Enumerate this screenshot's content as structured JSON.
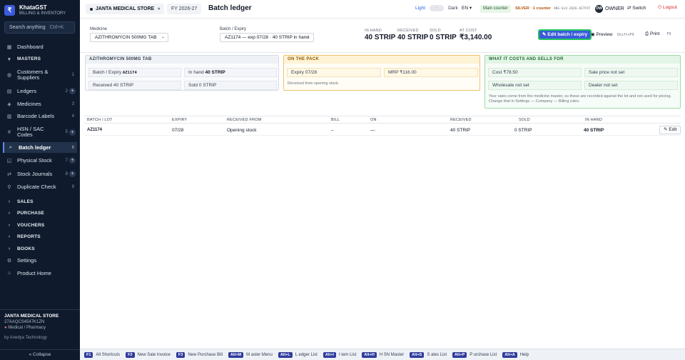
{
  "brand": {
    "logo": "₹",
    "name": "KhataGST",
    "sub": "BILLING & INVENTORY"
  },
  "sidebar": {
    "search_placeholder": "Search anything",
    "search_kbd": "Ctrl+K",
    "items": [
      {
        "label": "Dashboard",
        "icon": "▦"
      },
      {
        "label": "MASTERS",
        "icon": "▾"
      },
      {
        "label": "Customers & Suppliers",
        "icon": "◍",
        "count": "1"
      },
      {
        "label": "Ledgers",
        "icon": "▤",
        "count": "2"
      },
      {
        "label": "Medicines",
        "icon": "◈",
        "count": "3"
      },
      {
        "label": "Barcode Labels",
        "icon": "▥",
        "count": "4"
      },
      {
        "label": "HSN / SAC Codes",
        "icon": "#",
        "count": "5"
      },
      {
        "label": "Batch ledger",
        "icon": "⌕",
        "count": "6"
      },
      {
        "label": "Physical Stock",
        "icon": "◱",
        "count": "7"
      },
      {
        "label": "Stock Journals",
        "icon": "⇄",
        "count": "8"
      },
      {
        "label": "Duplicate Check",
        "icon": "⚲",
        "count": "9"
      },
      {
        "label": "SALES",
        "icon": "›"
      },
      {
        "label": "PURCHASE",
        "icon": "›"
      },
      {
        "label": "VOUCHERS",
        "icon": "›"
      },
      {
        "label": "REPORTS",
        "icon": "›"
      },
      {
        "label": "BOOKS",
        "icon": "›"
      },
      {
        "label": "Settings",
        "icon": "⚙"
      },
      {
        "label": "Product Home",
        "icon": "⌂"
      }
    ],
    "plus": "+",
    "footer": {
      "store": "JANTA MEDICAL STORE",
      "gstin": "27AAQCS4547K1ZN",
      "type": "Medical / Pharmacy",
      "by": "by Anedya Technology"
    },
    "collapse": "« Collapse"
  },
  "topbar": {
    "store": "JANTA MEDICAL STORE",
    "fy": "FY 2026-27",
    "title": "Batch ledger",
    "light": "Light",
    "dark": "Dark",
    "lang": "EN",
    "main_counter": "Main counter",
    "plan": "SILVER · 1 counter",
    "plan_code": "ANS-SLV-2026-4E7F97",
    "avatar": "OW",
    "role": "OWNER",
    "switch": "Switch",
    "logout": "Logout"
  },
  "filters": {
    "medicine_label": "Medicine",
    "medicine_value": "AZITHROMYCIN 500MG TAB",
    "batch_label": "Batch / Expiry",
    "batch_value": "AZ1174 — exp 07/28 · 40 STRIP in hand"
  },
  "stats": [
    {
      "label": "IN HAND",
      "value": "40 STRIP"
    },
    {
      "label": "RECEIVED",
      "value": "40 STRIP"
    },
    {
      "label": "SOLD",
      "value": "0 STRIP"
    },
    {
      "label": "AT COST",
      "value": "₹3,140.00"
    }
  ],
  "actions": {
    "edit": "✎ Edit batch / expiry",
    "preview": "◉ Preview",
    "preview_kbd": "Shift+F9",
    "print": "⎙ Print",
    "print_kbd": "F9"
  },
  "card_batch": {
    "title": "AZITHROMYCIN 500MG TAB",
    "batch_label": "Batch / Expiry",
    "batch_value": "AZ1174",
    "inhand_label": "In hand",
    "inhand_value": "40 STRIP",
    "received_label": "Received",
    "received_value": "40 STRIP",
    "sold_label": "Sold",
    "sold_value": "0 STRIP"
  },
  "card_pack": {
    "title": "ON THE PACK",
    "expiry_label": "Expiry",
    "expiry_value": "07/28",
    "mrp_label": "MRP",
    "mrp_value": "₹116.00",
    "note": "Received from opening stock."
  },
  "card_costs": {
    "title": "WHAT IT COSTS AND SELLS FOR",
    "cost_label": "Cost",
    "cost_value": "₹78.50",
    "sale_label": "Sale price",
    "sale_value": "not set",
    "wholesale_label": "Wholesale",
    "wholesale_value": "not set",
    "dealer_label": "Dealer",
    "dealer_value": "not set",
    "note": "Your rates come from the medicine master, so these are recorded against the lot and not used for pricing. Change that in Settings — Company — Billing rules."
  },
  "table": {
    "headers": [
      "BATCH / LOT",
      "EXPIRY",
      "RECEIVED FROM",
      "BILL",
      "ON",
      "RECEIVED",
      "SOLD",
      "IN HAND"
    ],
    "rows": [
      {
        "batch": "AZ1174",
        "expiry": "07/28",
        "from": "Opening stock",
        "bill": "–",
        "on": "—",
        "received": "40 STRIP",
        "sold": "0 STRIP",
        "inhand": "40 STRIP",
        "edit": "✎ Edit"
      }
    ]
  },
  "shortcuts": [
    {
      "key": "F1",
      "label": "All Shortcuts"
    },
    {
      "key": "F2",
      "label": "New Sale Invoice"
    },
    {
      "key": "F3",
      "label": "New Purchase Bill"
    },
    {
      "key": "Alt+M",
      "label": "M aster Menu"
    },
    {
      "key": "Alt+L",
      "label": "L edger List"
    },
    {
      "key": "Alt+I",
      "label": "I tem List"
    },
    {
      "key": "Alt+H",
      "label": "H SN Master"
    },
    {
      "key": "Alt+S",
      "label": "S ales List"
    },
    {
      "key": "Alt+P",
      "label": "P urchase List"
    },
    {
      "key": "Alt+A",
      "label": "Help"
    }
  ]
}
